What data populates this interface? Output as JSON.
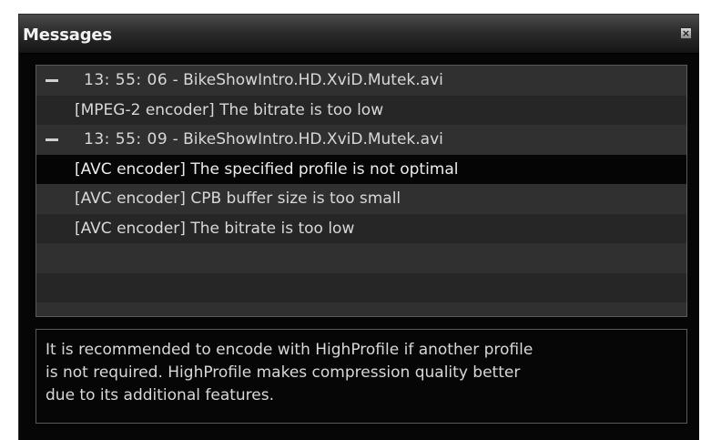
{
  "window": {
    "title": "Messages",
    "close_glyph": "×"
  },
  "messages": {
    "groups": [
      {
        "time": "13: 55: 06",
        "separator": " - ",
        "file": "BikeShowIntro.HD.XviD.Mutek.avi",
        "items": [
          "[MPEG-2 encoder] The bitrate is too low"
        ]
      },
      {
        "time": "13: 55: 09",
        "separator": " - ",
        "file": "BikeShowIntro.HD.XviD.Mutek.avi",
        "items": [
          "[AVC encoder] The specified profile is not optimal",
          "[AVC encoder] CPB buffer size is too small",
          "[AVC encoder] The bitrate is too low"
        ]
      }
    ],
    "selected_item": "[AVC encoder] The specified profile is not optimal"
  },
  "description": {
    "lines": [
      "It is recommended to encode with HighProfile if another profile",
      "is not required. HighProfile makes compression quality better",
      "due to its additional features."
    ]
  },
  "colors": {
    "background": "#060606",
    "text": "#d8d8d8",
    "selected_row": "#050505",
    "border": "#5a5a5a"
  },
  "icons": {
    "collapse": "minus-icon",
    "close": "close-icon"
  }
}
